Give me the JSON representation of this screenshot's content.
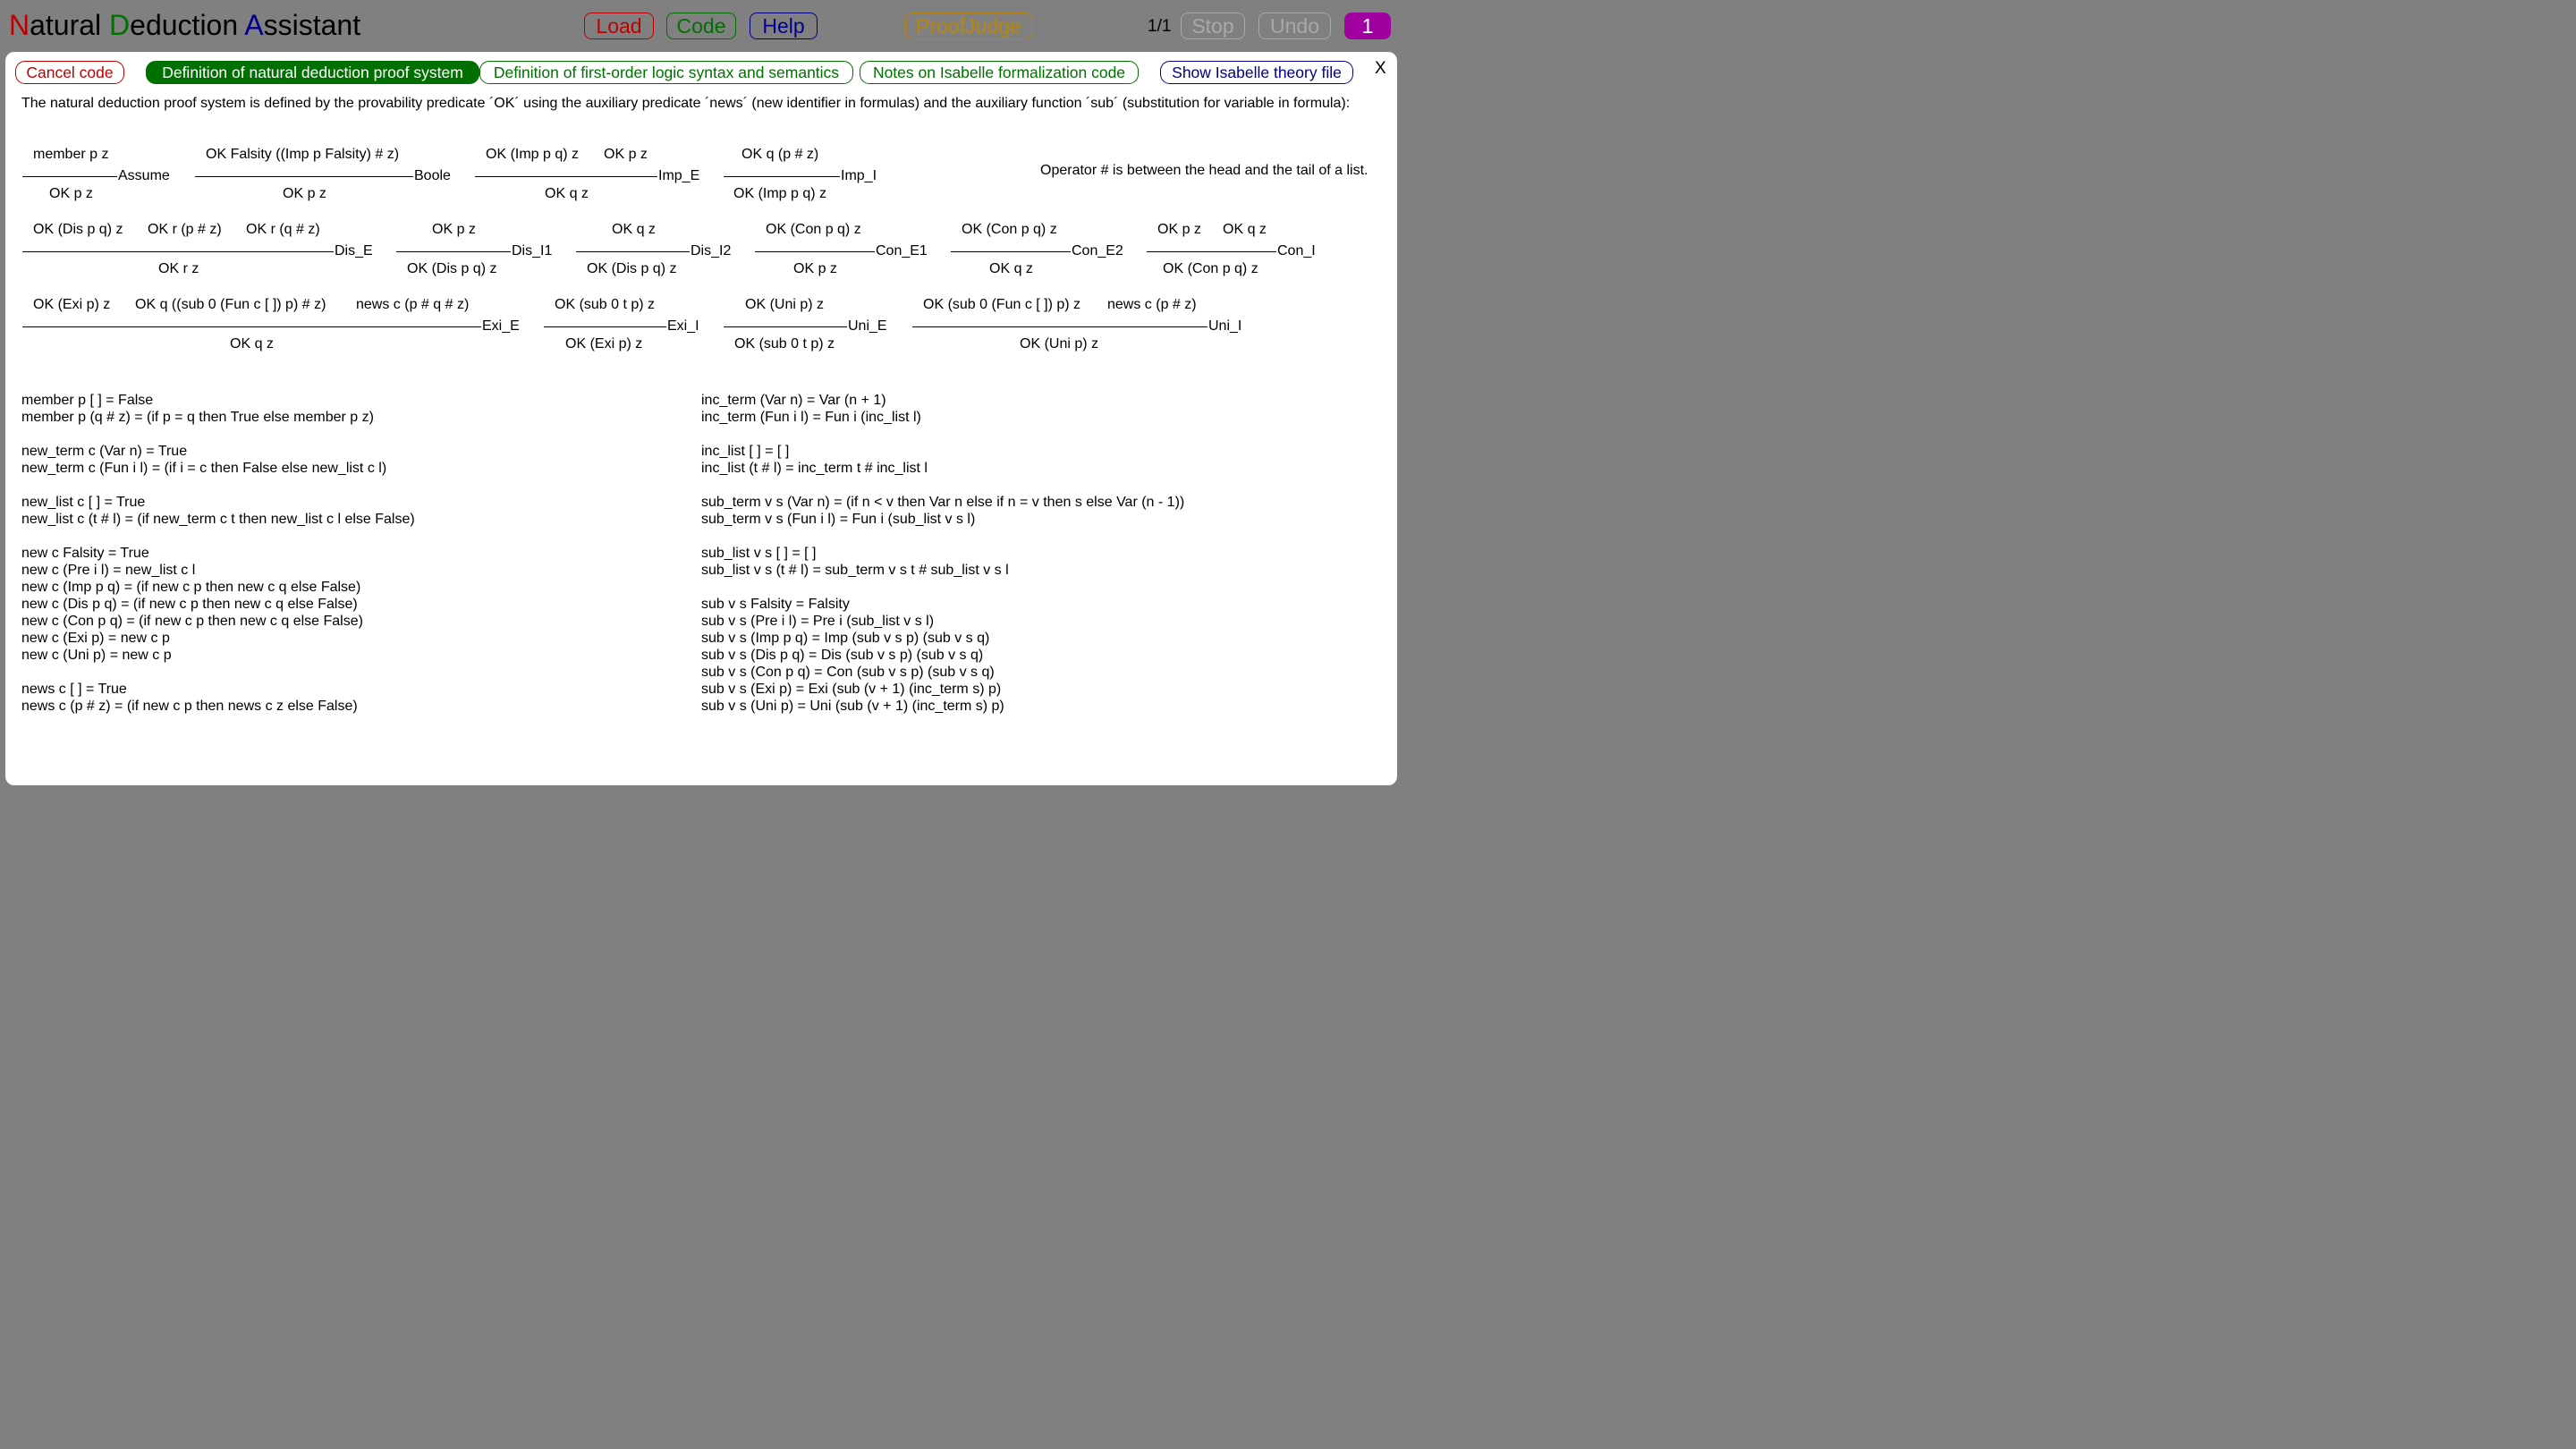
{
  "app": {
    "title_parts": [
      "N",
      "at",
      "ural ",
      "D",
      "eduction ",
      "A",
      "ssistant"
    ]
  },
  "toolbar": {
    "load": "Load",
    "code": "Code",
    "help": "Help",
    "proofjudge": "ProofJudge",
    "counter": "1/1",
    "stop": "Stop",
    "undo": "Undo",
    "step": "1"
  },
  "tabs": {
    "cancel": "Cancel code",
    "definition": "Definition of natural deduction proof system",
    "fol": "Definition of first-order logic syntax and semantics",
    "notes": "Notes on Isabelle formalization code",
    "show": "Show Isabelle theory file",
    "close": "X"
  },
  "intro": "The natural deduction proof system is defined by the provability predicate ´OK´ using the auxiliary predicate ´news´ (new identifier in formulas) and the auxiliary function ´sub´ (substitution for variable in formula):",
  "note": "Operator # is between the head and the tail of a list.",
  "rules": [
    {
      "premises": [
        "member p z"
      ],
      "name": "Assume",
      "conclusion": "OK p z"
    },
    {
      "premises": [
        "OK Falsity ((Imp p Falsity) # z)"
      ],
      "name": "Boole",
      "conclusion": "OK p z"
    },
    {
      "premises": [
        "OK (Imp p q) z",
        "OK p z"
      ],
      "name": "Imp_E",
      "conclusion": "OK q z"
    },
    {
      "premises": [
        "OK q (p # z)"
      ],
      "name": "Imp_I",
      "conclusion": "OK (Imp p q) z"
    },
    {
      "premises": [
        "OK (Dis p q) z",
        "OK r (p # z)",
        "OK r (q # z)"
      ],
      "name": "Dis_E",
      "conclusion": "OK r z"
    },
    {
      "premises": [
        "OK p z"
      ],
      "name": "Dis_I1",
      "conclusion": "OK (Dis p q) z"
    },
    {
      "premises": [
        "OK q z"
      ],
      "name": "Dis_I2",
      "conclusion": "OK (Dis p q) z"
    },
    {
      "premises": [
        "OK (Con p q) z"
      ],
      "name": "Con_E1",
      "conclusion": "OK p z"
    },
    {
      "premises": [
        "OK (Con p q) z"
      ],
      "name": "Con_E2",
      "conclusion": "OK q z"
    },
    {
      "premises": [
        "OK p z",
        "OK q z"
      ],
      "name": "Con_I",
      "conclusion": "OK (Con p q) z"
    },
    {
      "premises": [
        "OK (Exi p) z",
        "OK q ((sub 0 (Fun c [ ]) p) # z)",
        "news c (p # q # z)"
      ],
      "name": "Exi_E",
      "conclusion": "OK q z"
    },
    {
      "premises": [
        "OK (sub 0 t p) z"
      ],
      "name": "Exi_I",
      "conclusion": "OK (Exi p) z"
    },
    {
      "premises": [
        "OK (Uni p) z"
      ],
      "name": "Uni_E",
      "conclusion": "OK (sub 0 t p) z"
    },
    {
      "premises": [
        "OK (sub 0 (Fun c [ ]) p) z",
        "news c (p # z)"
      ],
      "name": "Uni_I",
      "conclusion": "OK (Uni p) z"
    }
  ],
  "defs_left": [
    "member p [ ] = False",
    "member p (q # z)  =  (if p = q then True else member p z)",
    "",
    "new_term c (Var n)  =  True",
    "new_term c (Fun i l)  =  (if i = c then False else new_list c l)",
    "",
    "new_list c [ ]  =  True",
    "new_list c (t # l)  =  (if new_term c t then new_list c l else False)",
    "",
    "new c Falsity  =  True",
    "new c (Pre i l)  =  new_list c l",
    "new c (Imp  p q)  =  (if new c p then new c q else False)",
    "new c (Dis  p q)  =  (if new c p then new c q else False)",
    "new c (Con p q)  =  (if new c p then new c q else False)",
    "new c (Exi  p)  =  new c p",
    "new c (Uni  p)  =  new c p",
    "",
    "news c [ ]  =  True",
    "news c (p # z)  =  (if new c p then news c z else False)"
  ],
  "defs_right": [
    "inc_term (Var n)  =  Var (n + 1)",
    "inc_term (Fun i l)  =  Fun i (inc_list l)",
    "",
    "inc_list [ ]  =  [ ]",
    "inc_list (t # l)  =  inc_term t  #  inc_list l",
    "",
    "sub_term v s (Var n)  =  (if n < v then Var n else if n = v then s else Var (n - 1))",
    "sub_term v s (Fun i l)  =  Fun i (sub_list v s l)",
    "",
    "sub_list v s [ ]  =  [ ]",
    "sub_list v s (t # l)  =  sub_term v s t  #  sub_list v s l",
    "",
    "sub v s Falsity  =  Falsity",
    "sub v s (Pre i l)  =  Pre i (sub_list v s l)",
    "sub v s (Imp  p q)  =  Imp  (sub v s p) (sub v s q)",
    "sub v s (Dis  p q)  =  Dis  (sub v s p) (sub v s q)",
    "sub v s (Con p q)  =  Con (sub v s p) (sub v s q)",
    "sub v s (Exi  p)  =  Exi  (sub (v + 1) (inc_term s) p)",
    "sub v s (Uni  p)  =  Uni  (sub (v + 1) (inc_term s) p)"
  ],
  "colors": {
    "red": "#c00000",
    "green": "#007000",
    "blue": "#00008b",
    "orange": "#b8860b",
    "purple": "#a000a0",
    "gray": "#a8a8a8"
  }
}
